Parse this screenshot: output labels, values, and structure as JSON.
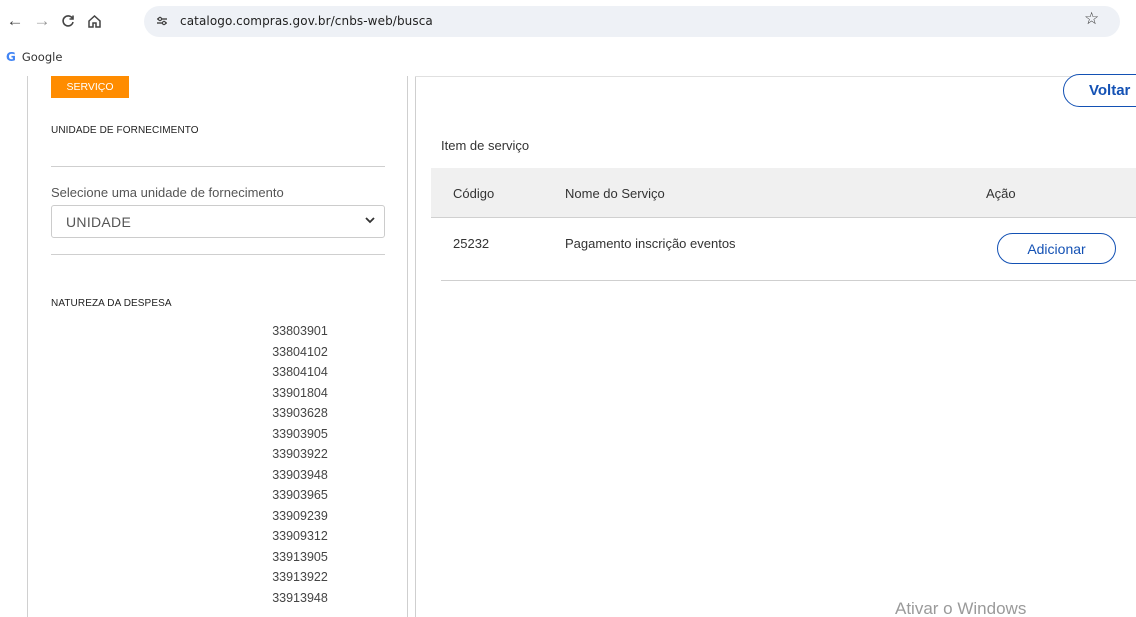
{
  "browser": {
    "url": "catalogo.compras.gov.br/cnbs-web/busca",
    "bookmarks": [
      {
        "label": "Google",
        "icon": "google-g-icon"
      }
    ]
  },
  "left": {
    "type_tag": "SERVIÇO",
    "supply_unit_heading": "UNIDADE DE FORNECIMENTO",
    "supply_unit_select": {
      "label": "Selecione uma unidade de fornecimento",
      "value": "UNIDADE"
    },
    "expense_nature_heading": "NATUREZA DA DESPESA",
    "expense_codes": [
      "33803901",
      "33804102",
      "33804104",
      "33901804",
      "33903628",
      "33903905",
      "33903922",
      "33903948",
      "33903965",
      "33909239",
      "33909312",
      "33913905",
      "33913922",
      "33913948"
    ]
  },
  "main": {
    "back_button": "Voltar",
    "section_title": "Item de serviço",
    "table": {
      "columns": [
        "Código",
        "Nome do Serviço",
        "Ação"
      ],
      "rows": [
        {
          "code": "25232",
          "name": "Pagamento inscrição eventos",
          "action": "Adicionar"
        }
      ]
    }
  },
  "os_watermark": "Ativar o Windows",
  "colors": {
    "accent": "#1351b4",
    "tag": "#ff8c00"
  }
}
